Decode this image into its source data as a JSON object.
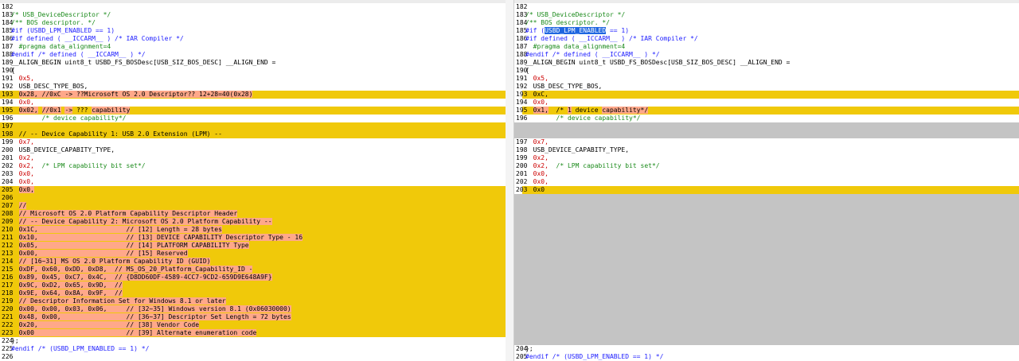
{
  "left": {
    "lines": [
      {
        "n": "182",
        "segs": [],
        "type": ""
      },
      {
        "n": "183",
        "segs": [
          {
            "t": "/* USB_DeviceDescriptor */",
            "c": "c"
          }
        ],
        "type": ""
      },
      {
        "n": "184",
        "segs": [
          {
            "t": "/** BOS descriptor. */",
            "c": "c"
          }
        ],
        "type": ""
      },
      {
        "n": "185",
        "segs": [
          {
            "t": "#if (USBD_LPM_ENABLED == 1)",
            "c": "p"
          }
        ],
        "type": ""
      },
      {
        "n": "186",
        "segs": [
          {
            "t": "#if defined ( __ICCARM__ ) /* IAR Compiler */",
            "c": "p"
          }
        ],
        "type": ""
      },
      {
        "n": "187",
        "segs": [
          {
            "t": "  #pragma data_alignment=4",
            "c": "c"
          }
        ],
        "type": ""
      },
      {
        "n": "188",
        "segs": [
          {
            "t": "#endif /* defined ( __ICCARM__ ) */",
            "c": "p"
          }
        ],
        "type": ""
      },
      {
        "n": "189",
        "segs": [
          {
            "t": "__ALIGN_BEGIN uint8_t USBD_FS_BOSDesc[USB_SIZ_BOS_DESC] __ALIGN_END =",
            "c": ""
          }
        ],
        "type": ""
      },
      {
        "n": "190",
        "segs": [
          {
            "t": "{",
            "c": ""
          }
        ],
        "type": ""
      },
      {
        "n": "191",
        "segs": [
          {
            "t": "  0x5,",
            "c": "n"
          }
        ],
        "type": ""
      },
      {
        "n": "192",
        "segs": [
          {
            "t": "  USB_DESC_TYPE_BOS,",
            "c": ""
          }
        ],
        "type": ""
      },
      {
        "n": "193",
        "segs": [
          {
            "t": "  ",
            "c": ""
          },
          {
            "t": "0x28, //0xC -> ??Microsoft OS 2.0 Descriptor?? 12+28=40(0x28)",
            "c": "hl"
          }
        ],
        "type": "mod"
      },
      {
        "n": "194",
        "segs": [
          {
            "t": "  0x0,",
            "c": "n"
          }
        ],
        "type": ""
      },
      {
        "n": "195",
        "segs": [
          {
            "t": "  ",
            "c": ""
          },
          {
            "t": "0x02,",
            "c": "hl"
          },
          {
            "t": " ",
            "c": ""
          },
          {
            "t": "//0x1",
            "c": "hl"
          },
          {
            "t": " ",
            "c": ""
          },
          {
            "t": "->",
            "c": "hl"
          },
          {
            "t": " ??? ",
            "c": ""
          },
          {
            "t": "capability",
            "c": "hl"
          }
        ],
        "type": "mod"
      },
      {
        "n": "196",
        "segs": [
          {
            "t": "        /* device capability*/",
            "c": "c"
          }
        ],
        "type": ""
      },
      {
        "n": "197",
        "segs": [],
        "type": "mod"
      },
      {
        "n": "198",
        "segs": [
          {
            "t": "  // -- Device Capability 1: USB 2.0 Extension (LPM) --",
            "c": ""
          }
        ],
        "type": "mod"
      },
      {
        "n": "199",
        "segs": [
          {
            "t": "  0x7,",
            "c": "n"
          }
        ],
        "type": ""
      },
      {
        "n": "200",
        "segs": [
          {
            "t": "  USB_DEVICE_CAPABITY_TYPE,",
            "c": ""
          }
        ],
        "type": ""
      },
      {
        "n": "201",
        "segs": [
          {
            "t": "  0x2,",
            "c": "n"
          }
        ],
        "type": ""
      },
      {
        "n": "202",
        "segs": [
          {
            "t": "  0x2,",
            "c": "n"
          },
          {
            "t": "  /* LPM capability bit set*/",
            "c": "c"
          }
        ],
        "type": ""
      },
      {
        "n": "203",
        "segs": [
          {
            "t": "  0x0,",
            "c": "n"
          }
        ],
        "type": ""
      },
      {
        "n": "204",
        "segs": [
          {
            "t": "  0x0,",
            "c": "n"
          }
        ],
        "type": ""
      },
      {
        "n": "205",
        "segs": [
          {
            "t": "  ",
            "c": ""
          },
          {
            "t": "0x0,",
            "c": "hl"
          }
        ],
        "type": "mod"
      },
      {
        "n": "206",
        "segs": [],
        "type": "mod"
      },
      {
        "n": "207",
        "segs": [
          {
            "t": "  ",
            "c": ""
          },
          {
            "t": "//",
            "c": "hl"
          }
        ],
        "type": "mod"
      },
      {
        "n": "208",
        "segs": [
          {
            "t": "  ",
            "c": ""
          },
          {
            "t": "// Microsoft OS 2.0 Platform Capability Descriptor Header",
            "c": "hl"
          }
        ],
        "type": "mod"
      },
      {
        "n": "209",
        "segs": [
          {
            "t": "  ",
            "c": ""
          },
          {
            "t": "// -- Device Capability 2: Microsoft OS 2.0 Platform Capability --",
            "c": "hl"
          }
        ],
        "type": "mod"
      },
      {
        "n": "210",
        "segs": [
          {
            "t": "  ",
            "c": ""
          },
          {
            "t": "0x1C,                       // [12] Length = 28 bytes",
            "c": "hl"
          }
        ],
        "type": "mod"
      },
      {
        "n": "211",
        "segs": [
          {
            "t": "  ",
            "c": ""
          },
          {
            "t": "0x10,                       // [13] DEVICE CAPABILITY Descriptor Type - 16",
            "c": "hl"
          }
        ],
        "type": "mod"
      },
      {
        "n": "212",
        "segs": [
          {
            "t": "  ",
            "c": ""
          },
          {
            "t": "0x05,                       // [14] PLATFORM CAPABILITY Type",
            "c": "hl"
          }
        ],
        "type": "mod"
      },
      {
        "n": "213",
        "segs": [
          {
            "t": "  ",
            "c": ""
          },
          {
            "t": "0x00,                       // [15] Reserved",
            "c": "hl"
          }
        ],
        "type": "mod"
      },
      {
        "n": "214",
        "segs": [
          {
            "t": "  ",
            "c": ""
          },
          {
            "t": "// [16~31] MS OS 2.0 Platform Capability ID (GUID)",
            "c": "hl"
          }
        ],
        "type": "mod"
      },
      {
        "n": "215",
        "segs": [
          {
            "t": "  ",
            "c": ""
          },
          {
            "t": "0xDF, 0x60, 0xDD, 0xD8,  // MS_OS_20_Platform_Capability_ID -",
            "c": "hl"
          }
        ],
        "type": "mod"
      },
      {
        "n": "216",
        "segs": [
          {
            "t": "  ",
            "c": ""
          },
          {
            "t": "0x89, 0x45, 0xC7, 0x4C,  // {D8DD60DF-4589-4CC7-9CD2-659D9E648A9F}",
            "c": "hl"
          }
        ],
        "type": "mod"
      },
      {
        "n": "217",
        "segs": [
          {
            "t": "  ",
            "c": ""
          },
          {
            "t": "0x9C, 0xD2, 0x65, 0x9D,  //",
            "c": "hl"
          }
        ],
        "type": "mod"
      },
      {
        "n": "218",
        "segs": [
          {
            "t": "  ",
            "c": ""
          },
          {
            "t": "0x9E, 0x64, 0x8A, 0x9F,  //",
            "c": "hl"
          }
        ],
        "type": "mod"
      },
      {
        "n": "219",
        "segs": [
          {
            "t": "  ",
            "c": ""
          },
          {
            "t": "// Descriptor Information Set for Windows 8.1 or later",
            "c": "hl"
          }
        ],
        "type": "mod"
      },
      {
        "n": "220",
        "segs": [
          {
            "t": "  ",
            "c": ""
          },
          {
            "t": "0x00, 0x00, 0x03, 0x06,     // [32~35] Windows version 8.1 (0x06030000)",
            "c": "hl"
          }
        ],
        "type": "mod"
      },
      {
        "n": "221",
        "segs": [
          {
            "t": "  ",
            "c": ""
          },
          {
            "t": "0x48, 0x00,                 // [36~37] Descriptor Set Length = 72 bytes",
            "c": "hl"
          }
        ],
        "type": "mod"
      },
      {
        "n": "222",
        "segs": [
          {
            "t": "  ",
            "c": ""
          },
          {
            "t": "0x20,                       // [38] Vendor Code",
            "c": "hl"
          }
        ],
        "type": "mod"
      },
      {
        "n": "223",
        "segs": [
          {
            "t": "  ",
            "c": ""
          },
          {
            "t": "0x00                        // [39] Alternate enumeration code",
            "c": "hl"
          }
        ],
        "type": "mod"
      },
      {
        "n": "224",
        "segs": [
          {
            "t": "};",
            "c": ""
          }
        ],
        "type": ""
      },
      {
        "n": "225",
        "segs": [
          {
            "t": "#endif /* (USBD_LPM_ENABLED == 1) */",
            "c": "p"
          }
        ],
        "type": ""
      },
      {
        "n": "226",
        "segs": [],
        "type": ""
      }
    ]
  },
  "right": {
    "lines": [
      {
        "n": "182",
        "segs": [],
        "type": ""
      },
      {
        "n": "183",
        "segs": [
          {
            "t": "/* USB_DeviceDescriptor */",
            "c": "c"
          }
        ],
        "type": ""
      },
      {
        "n": "184",
        "segs": [
          {
            "t": "/** BOS descriptor. */",
            "c": "c"
          }
        ],
        "type": ""
      },
      {
        "n": "185",
        "segs": [
          {
            "t": "#if (",
            "c": "p"
          },
          {
            "t": "USBD_LPM_ENABLED",
            "c": "sel"
          },
          {
            "t": " == 1)",
            "c": "p"
          }
        ],
        "type": ""
      },
      {
        "n": "186",
        "segs": [
          {
            "t": "#if defined ( __ICCARM__ ) /* IAR Compiler */",
            "c": "p"
          }
        ],
        "type": ""
      },
      {
        "n": "187",
        "segs": [
          {
            "t": "  #pragma data_alignment=4",
            "c": "c"
          }
        ],
        "type": ""
      },
      {
        "n": "188",
        "segs": [
          {
            "t": "#endif /* defined ( __ICCARM__ ) */",
            "c": "p"
          }
        ],
        "type": ""
      },
      {
        "n": "189",
        "segs": [
          {
            "t": "__ALIGN_BEGIN uint8_t USBD_FS_BOSDesc[USB_SIZ_BOS_DESC] __ALIGN_END =",
            "c": ""
          }
        ],
        "type": ""
      },
      {
        "n": "190",
        "segs": [
          {
            "t": "{",
            "c": ""
          }
        ],
        "type": ""
      },
      {
        "n": "191",
        "segs": [
          {
            "t": "  0x5,",
            "c": "n"
          }
        ],
        "type": ""
      },
      {
        "n": "192",
        "segs": [
          {
            "t": "  USB_DESC_TYPE_BOS,",
            "c": ""
          }
        ],
        "type": ""
      },
      {
        "n": "193",
        "segs": [
          {
            "t": "  0xC,",
            "c": ""
          }
        ],
        "type": "mod"
      },
      {
        "n": "194",
        "segs": [
          {
            "t": "  0x0,",
            "c": "n"
          }
        ],
        "type": ""
      },
      {
        "n": "195",
        "segs": [
          {
            "t": "  ",
            "c": ""
          },
          {
            "t": "0x1,",
            "c": "hl"
          },
          {
            "t": "  /* ",
            "c": ""
          },
          {
            "t": "1",
            "c": "hl"
          },
          {
            "t": " device ",
            "c": ""
          },
          {
            "t": "capability*/",
            "c": "hl"
          }
        ],
        "type": "mod"
      },
      {
        "n": "196",
        "segs": [
          {
            "t": "        /* device capability*/",
            "c": "c"
          }
        ],
        "type": ""
      },
      {
        "n": "",
        "segs": [],
        "type": "gap"
      },
      {
        "n": "",
        "segs": [],
        "type": "gap"
      },
      {
        "n": "197",
        "segs": [
          {
            "t": "  0x7,",
            "c": "n"
          }
        ],
        "type": ""
      },
      {
        "n": "198",
        "segs": [
          {
            "t": "  USB_DEVICE_CAPABITY_TYPE,",
            "c": ""
          }
        ],
        "type": ""
      },
      {
        "n": "199",
        "segs": [
          {
            "t": "  0x2,",
            "c": "n"
          }
        ],
        "type": ""
      },
      {
        "n": "200",
        "segs": [
          {
            "t": "  0x2,",
            "c": "n"
          },
          {
            "t": "  /* LPM capability bit set*/",
            "c": "c"
          }
        ],
        "type": ""
      },
      {
        "n": "201",
        "segs": [
          {
            "t": "  0x0,",
            "c": "n"
          }
        ],
        "type": ""
      },
      {
        "n": "202",
        "segs": [
          {
            "t": "  0x0,",
            "c": "n"
          }
        ],
        "type": ""
      },
      {
        "n": "203",
        "segs": [
          {
            "t": "  0x0",
            "c": ""
          }
        ],
        "type": "mod"
      },
      {
        "n": "",
        "segs": [],
        "type": "gap"
      },
      {
        "n": "",
        "segs": [],
        "type": "gap"
      },
      {
        "n": "",
        "segs": [],
        "type": "gap"
      },
      {
        "n": "",
        "segs": [],
        "type": "gap"
      },
      {
        "n": "",
        "segs": [],
        "type": "gap"
      },
      {
        "n": "",
        "segs": [],
        "type": "gap"
      },
      {
        "n": "",
        "segs": [],
        "type": "gap"
      },
      {
        "n": "",
        "segs": [],
        "type": "gap"
      },
      {
        "n": "",
        "segs": [],
        "type": "gap"
      },
      {
        "n": "",
        "segs": [],
        "type": "gap"
      },
      {
        "n": "",
        "segs": [],
        "type": "gap"
      },
      {
        "n": "",
        "segs": [],
        "type": "gap"
      },
      {
        "n": "",
        "segs": [],
        "type": "gap"
      },
      {
        "n": "",
        "segs": [],
        "type": "gap"
      },
      {
        "n": "",
        "segs": [],
        "type": "gap"
      },
      {
        "n": "",
        "segs": [],
        "type": "gap"
      },
      {
        "n": "",
        "segs": [],
        "type": "gap"
      },
      {
        "n": "",
        "segs": [],
        "type": "gap"
      },
      {
        "n": "",
        "segs": [],
        "type": "gap"
      },
      {
        "n": "204",
        "segs": [
          {
            "t": "};",
            "c": ""
          }
        ],
        "type": ""
      },
      {
        "n": "205",
        "segs": [
          {
            "t": "#endif /* (USBD_LPM_ENABLED == 1) */",
            "c": "p"
          }
        ],
        "type": ""
      },
      {
        "n": "206",
        "segs": [],
        "type": ""
      }
    ]
  }
}
